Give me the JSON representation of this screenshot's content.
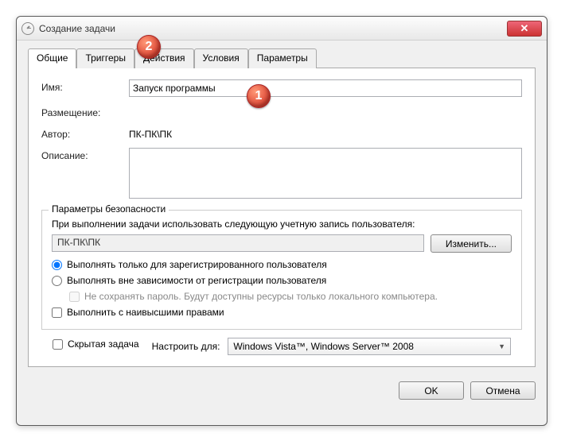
{
  "window": {
    "title": "Создание задачи",
    "close": "✕"
  },
  "tabs": {
    "general": "Общие",
    "triggers": "Триггеры",
    "actions": "Действия",
    "conditions": "Условия",
    "settings": "Параметры"
  },
  "form": {
    "name_label": "Имя:",
    "name_value": "Запуск программы",
    "location_label": "Размещение:",
    "location_value": "",
    "author_label": "Автор:",
    "author_value": "ПК-ПК\\ПК",
    "description_label": "Описание:",
    "description_value": ""
  },
  "security": {
    "legend": "Параметры безопасности",
    "account_label": "При выполнении задачи использовать следующую учетную запись пользователя:",
    "account_value": "ПК-ПК\\ПК",
    "change_btn": "Изменить...",
    "radio_logged": "Выполнять только для зарегистрированного пользователя",
    "radio_any": "Выполнять вне зависимости от регистрации пользователя",
    "nopass": "Не сохранять пароль. Будут доступны ресурсы только локального компьютера.",
    "highest": "Выполнить с наивысшими правами"
  },
  "bottom": {
    "hidden": "Скрытая задача",
    "config_label": "Настроить для:",
    "config_value": "Windows Vista™, Windows Server™ 2008"
  },
  "buttons": {
    "ok": "OK",
    "cancel": "Отмена"
  },
  "callouts": {
    "one": "1",
    "two": "2"
  }
}
